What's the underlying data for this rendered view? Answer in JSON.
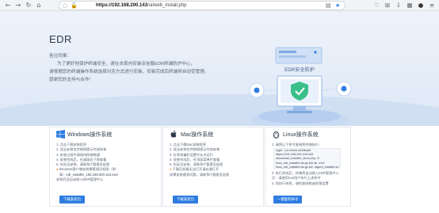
{
  "browser": {
    "url_host": "https://192.168.200.143",
    "url_path": "/ui/web_install.php"
  },
  "hero": {
    "title": "EDR",
    "greeting": "各位同事：",
    "paragraphs": [
      "为了更好地保护终端安全，请在本周内安装深信服EDR终端防护中心，",
      "请根据您的终端操作系统选择对应方式进行安装，安装完成后终端将自动受管理。",
      "感谢您的支持与合作！"
    ],
    "illustration_label": "EDR安全防护"
  },
  "cards": {
    "windows": {
      "title": "Windows操作系统",
      "steps": [
        "1. 点击下载安装程序",
        "2. 双击安装包并按照提示完成安装",
        "3. 安装过程中请保持网络畅通",
        "4. 安装完成后，在桌面右下角查看",
        "5. 如无法安装，请联系IT管理员处理"
      ],
      "warn": "Windows客户端安装需管理员权限（例",
      "code": "如：edr_installer_192.168.200.143.exe）",
      "tail": "安装后会自动接入EDR管理中心",
      "button": "下载安装包"
    },
    "mac": {
      "title": "Mac操作系统",
      "steps": [
        "1. 点击下载Mac安装程序",
        "2. 双击安装包并按照提示完成安装",
        "3. 在系统偏好设置中允许运行",
        "4. 安装完成后，在顶部菜单栏查看",
        "5. 如无法安装，请联系IT管理员处理"
      ],
      "warn": "下载后如遇无法打开请右键打开",
      "tail": "如果安装遇到问题，请联系IT管理员处理",
      "button": "下载安装包"
    },
    "linux": {
      "title": "Linux操作系统",
      "intro": "1. 请将以下命令复制到终端执行：",
      "code_lines": [
        "wget --no-check-certificate",
        "https://192.168.200.143:443",
        "/download_installer_linux.php -O",
        "linux_edr_installer.tar.gz && tar -zxvf",
        "linux_edr_installer.tar.gz && ./agent_installer.sh"
      ],
      "steps2": [
        "2. 执行完成后，终端将自动接入EDR管理中心",
        "3. 如执行失败，请检查网络或权限设置"
      ],
      "warn": "注：请使用root用户执行上述命令",
      "button": "一键复制命令"
    }
  },
  "colors": {
    "accent": "#2f7de1",
    "warn": "#f28c28",
    "windows_logo": "#2f7de1",
    "mac_logo": "#2d3a4b"
  }
}
